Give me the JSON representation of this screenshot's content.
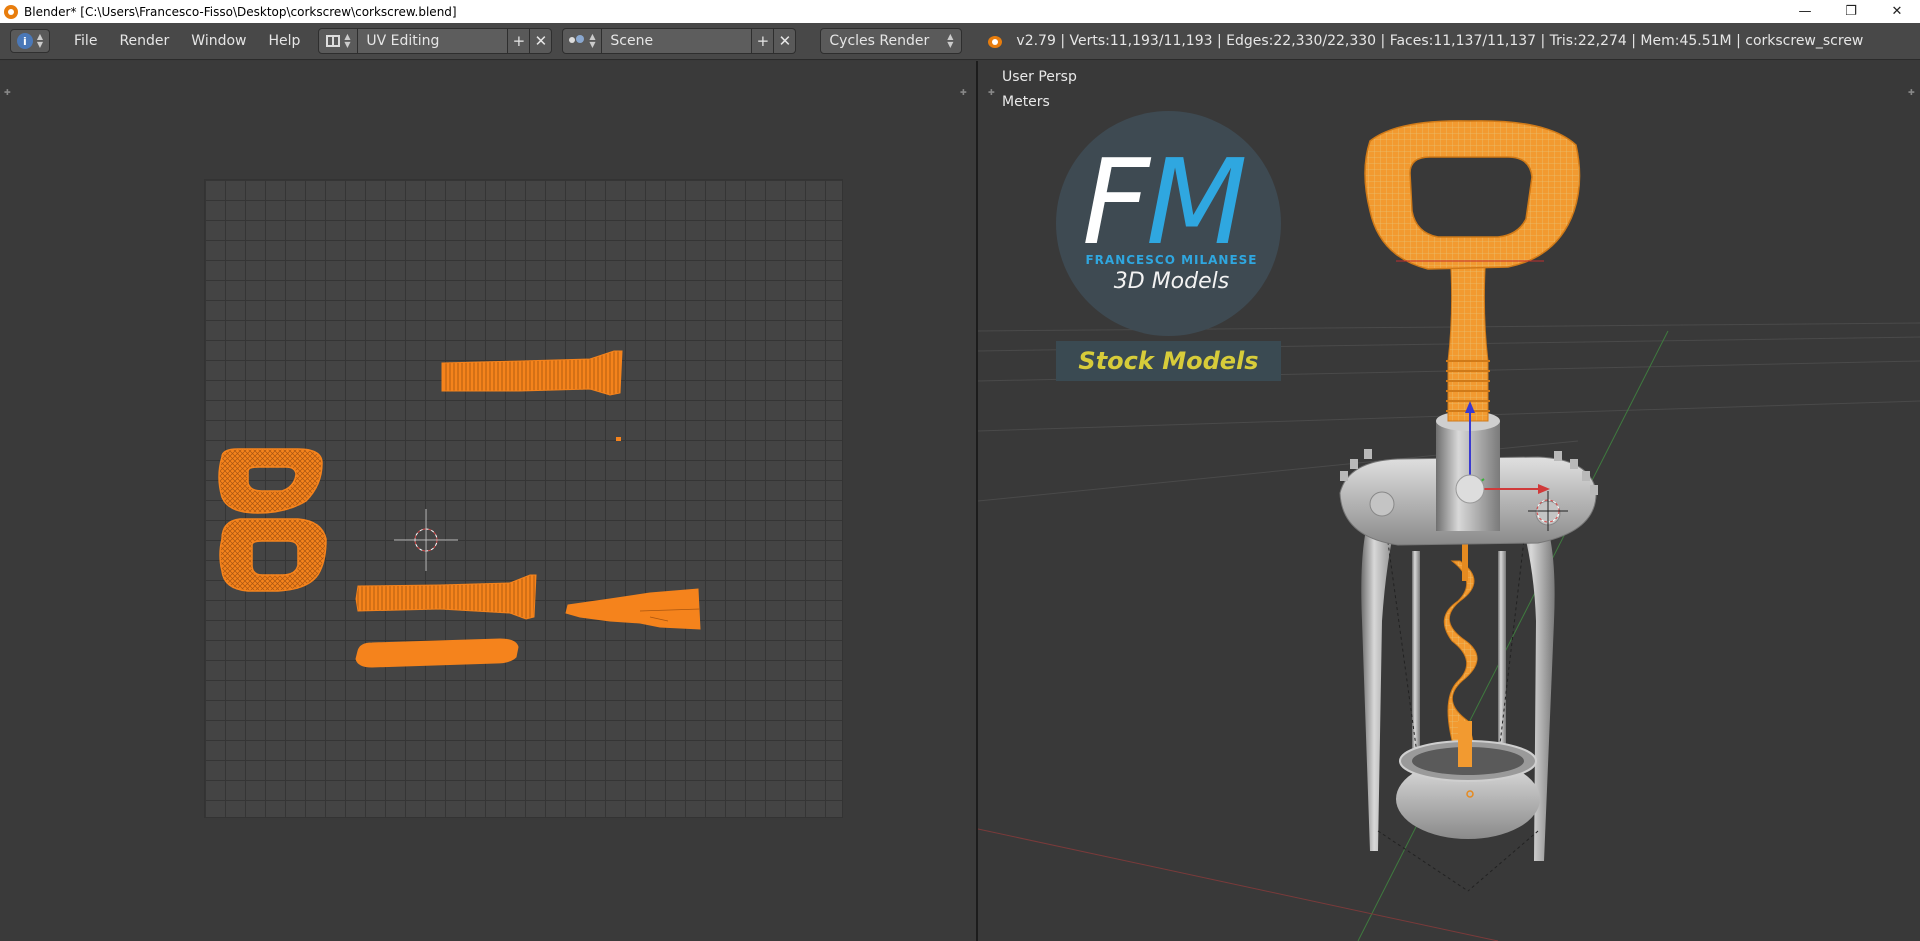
{
  "window": {
    "title": "Blender* [C:\\Users\\Francesco-Fisso\\Desktop\\corkscrew\\corkscrew.blend]",
    "minimize": "—",
    "restore": "❐",
    "close": "✕"
  },
  "header": {
    "menus": [
      "File",
      "Render",
      "Window",
      "Help"
    ],
    "layout_name": "UV Editing",
    "scene_name": "Scene",
    "render_engine": "Cycles Render",
    "stats": "v2.79 | Verts:11,193/11,193 | Edges:22,330/22,330 | Faces:11,137/11,137 | Tris:22,274 | Mem:45.51M | corkscrew_screw"
  },
  "viewport": {
    "perspective": "User Persp",
    "units": "Meters"
  },
  "logo": {
    "letter_f": "F",
    "letter_m": "M",
    "name": "FRANCESCO MILANESE",
    "subtitle": "3D Models",
    "stock_label": "Stock Models"
  },
  "colors": {
    "uv_selection": "#f5831c",
    "brand_blue": "#2fa7e0",
    "stock_yellow": "#d7cc3a",
    "header_bg": "#484848"
  }
}
